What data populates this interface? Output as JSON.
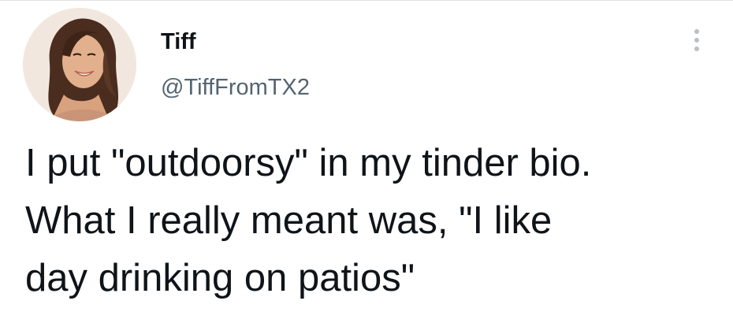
{
  "tweet": {
    "author": {
      "display_name": "Tiff",
      "handle": "@TiffFromTX2",
      "avatar_icon": "profile-photo"
    },
    "more_icon": "more-options-icon",
    "text_lines": [
      "I put \"outdoorsy\" in my tinder bio.",
      "What I really meant was, \"I like",
      "day drinking on patios\""
    ]
  },
  "colors": {
    "background": "#ffffff",
    "text": "#0f1419",
    "secondary_text": "#536471",
    "icon_gray": "#b9bfc4"
  }
}
